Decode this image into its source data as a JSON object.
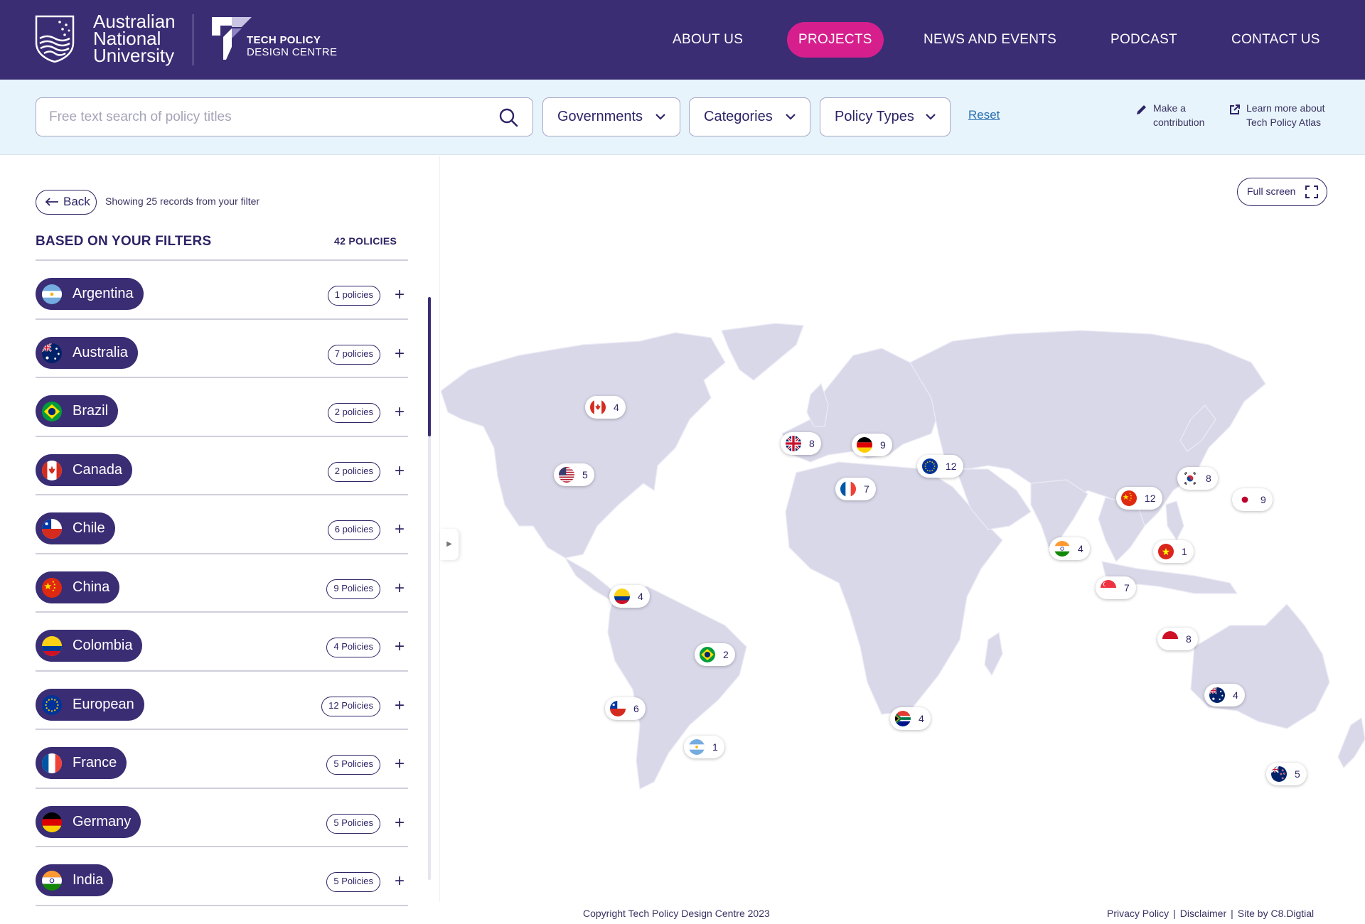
{
  "header": {
    "university": [
      "Australian",
      "National",
      "University"
    ],
    "centre_line1": "TECH POLICY",
    "centre_line2": "DESIGN CENTRE",
    "nav": [
      {
        "label": "ABOUT US",
        "active": false
      },
      {
        "label": "PROJECTS",
        "active": true
      },
      {
        "label": "NEWS AND EVENTS",
        "active": false
      },
      {
        "label": "PODCAST",
        "active": false
      },
      {
        "label": "CONTACT US",
        "active": false
      }
    ],
    "colors": {
      "bar": "#3a2d74",
      "active_pill": "#d61f8d"
    }
  },
  "filters": {
    "search_placeholder": "Free text search of policy titles",
    "search_value": "",
    "governments": "Governments",
    "categories": "Categories",
    "policy_types": "Policy Types",
    "reset": "Reset",
    "contribute": [
      "Make a",
      "contribution"
    ],
    "learn_more": [
      "Learn more about",
      "Tech Policy Atlas"
    ]
  },
  "panel": {
    "back": "Back",
    "showing": "Showing 25 records from your filter",
    "title": "BASED ON YOUR FILTERS",
    "total": "42 POLICIES",
    "countries": [
      {
        "name": "Argentina",
        "count": "1 policies",
        "flag": "argentina"
      },
      {
        "name": "Australia",
        "count": "7 policies",
        "flag": "australia"
      },
      {
        "name": "Brazil",
        "count": "2 policies",
        "flag": "brazil"
      },
      {
        "name": "Canada",
        "count": "2 policies",
        "flag": "canada"
      },
      {
        "name": "Chile",
        "count": "6 policies",
        "flag": "chile"
      },
      {
        "name": "China",
        "count": "9 Policies",
        "flag": "china"
      },
      {
        "name": "Colombia",
        "count": "4 Policies",
        "flag": "colombia"
      },
      {
        "name": "European",
        "count": "12 Policies",
        "flag": "eu"
      },
      {
        "name": "France",
        "count": "5 Policies",
        "flag": "france"
      },
      {
        "name": "Germany",
        "count": "5 Policies",
        "flag": "germany"
      },
      {
        "name": "India",
        "count": "5 Policies",
        "flag": "india"
      }
    ]
  },
  "map": {
    "fullscreen": "Full screen",
    "markers": [
      {
        "flag": "canada",
        "count": "4"
      },
      {
        "flag": "usa",
        "count": "5"
      },
      {
        "flag": "uk",
        "count": "8"
      },
      {
        "flag": "germany",
        "count": "9"
      },
      {
        "flag": "eu",
        "count": "12"
      },
      {
        "flag": "france",
        "count": "7"
      },
      {
        "flag": "south-korea",
        "count": "8"
      },
      {
        "flag": "japan",
        "count": "9"
      },
      {
        "flag": "china",
        "count": "12"
      },
      {
        "flag": "india",
        "count": "4"
      },
      {
        "flag": "vietnam",
        "count": "1"
      },
      {
        "flag": "singapore",
        "count": "7"
      },
      {
        "flag": "indonesia",
        "count": "8"
      },
      {
        "flag": "colombia",
        "count": "4"
      },
      {
        "flag": "brazil",
        "count": "2"
      },
      {
        "flag": "chile",
        "count": "6"
      },
      {
        "flag": "argentina",
        "count": "1"
      },
      {
        "flag": "south-africa",
        "count": "4"
      },
      {
        "flag": "australia",
        "count": "4"
      },
      {
        "flag": "new-zealand",
        "count": "5"
      }
    ],
    "land_color": "#d9d8e9"
  },
  "footer": {
    "copyright": "Copyright Tech Policy Design Centre 2023",
    "privacy": "Privacy Policy",
    "disclaimer": "Disclaimer",
    "site_by": "Site by C8.Digtial"
  }
}
